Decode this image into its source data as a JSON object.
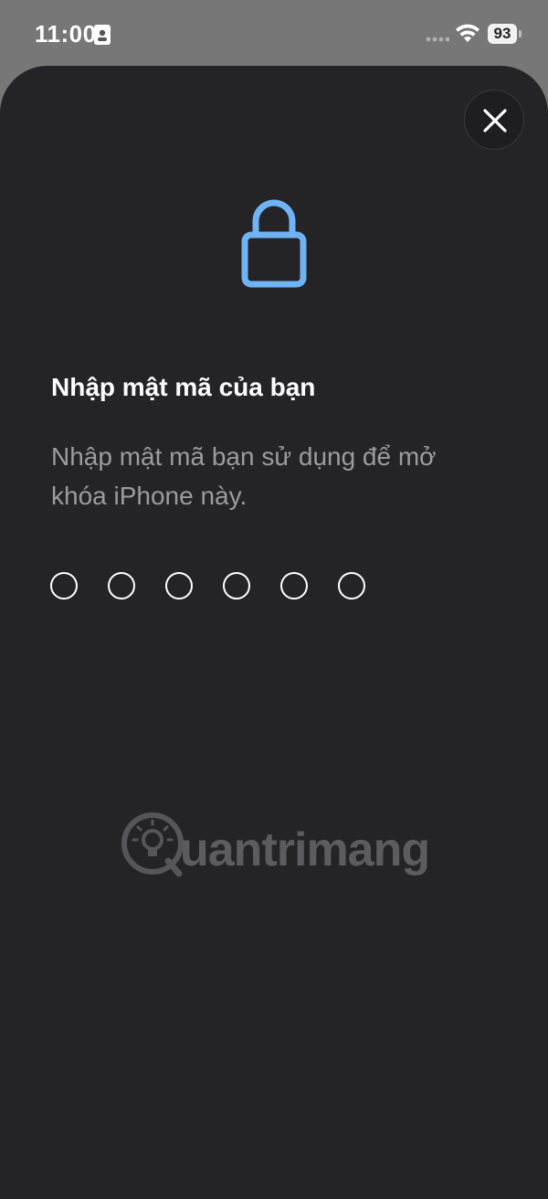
{
  "status_bar": {
    "time": "11:00",
    "battery_level": "93",
    "icons": [
      "id-card-icon",
      "signal-dots-icon",
      "wifi-icon",
      "battery-icon"
    ]
  },
  "sheet": {
    "close_icon": "close-icon",
    "lock_icon": "lock-icon",
    "title": "Nhập mật mã của bạn",
    "subtitle": "Nhập mật mã bạn sử dụng để mở khóa iPhone này.",
    "passcode_length": 6,
    "passcode_entered": 0
  },
  "watermark": {
    "text": "uantrimang"
  },
  "colors": {
    "background": "#777777",
    "sheet": "#242427",
    "accent": "#6fb3f5",
    "title": "#ffffff",
    "subtitle": "#9b9ba0"
  }
}
